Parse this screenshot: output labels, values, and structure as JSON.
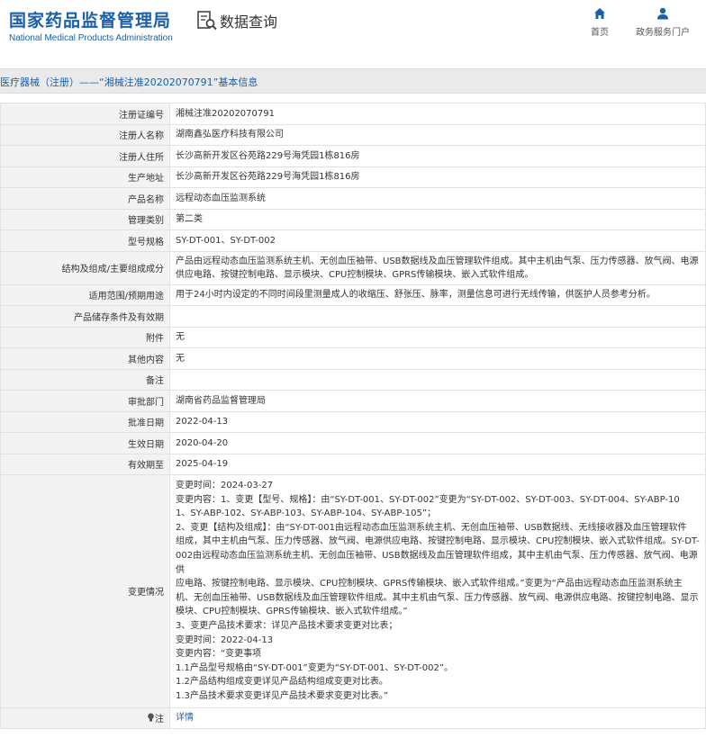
{
  "header": {
    "logo_cn": "国家药品监督管理局",
    "logo_en": "National Medical Products Administration",
    "query_title": "数据查询",
    "nav": [
      {
        "label": "首页",
        "icon": "home-icon"
      },
      {
        "label": "政务服务门户",
        "icon": "user-icon"
      }
    ]
  },
  "breadcrumb": "医疗器械（注册）——“湘械注准20202070791”基本信息",
  "rows": [
    {
      "label": "注册证编号",
      "value": "湘械注准20202070791"
    },
    {
      "label": "注册人名称",
      "value": "湖南鑫弘医疗科技有限公司"
    },
    {
      "label": "注册人住所",
      "value": "长沙高新开发区谷苑路229号海凭园1栋816房"
    },
    {
      "label": "生产地址",
      "value": "长沙高新开发区谷苑路229号海凭园1栋816房"
    },
    {
      "label": "产品名称",
      "value": "远程动态血压监测系统"
    },
    {
      "label": "管理类别",
      "value": "第二类"
    },
    {
      "label": "型号规格",
      "value": "SY-DT-001、SY-DT-002"
    },
    {
      "label": "结构及组成/主要组成成分",
      "value": "产品由远程动态血压监测系统主机、无创血压袖带、USB数据线及血压管理软件组成。其中主机由气泵、压力传感器、放气阀、电源供应电路、按键控制电路、显示模块、CPU控制模块、GPRS传输模块、嵌入式软件组成。"
    },
    {
      "label": "适用范围/预期用途",
      "value": "用于24小时内设定的不同时间段里测量成人的收缩压、舒张压、脉率，测量信息可进行无线传输，供医护人员参考分析。"
    },
    {
      "label": "产品储存条件及有效期",
      "value": ""
    },
    {
      "label": "附件",
      "value": "无"
    },
    {
      "label": "其他内容",
      "value": "无"
    },
    {
      "label": "备注",
      "value": ""
    },
    {
      "label": "审批部门",
      "value": "湖南省药品监督管理局"
    },
    {
      "label": "批准日期",
      "value": "2022-04-13"
    },
    {
      "label": "生效日期",
      "value": "2020-04-20"
    },
    {
      "label": "有效期至",
      "value": "2025-04-19"
    }
  ],
  "change": {
    "label": "变更情况",
    "lines": [
      "变更时间：2024-03-27",
      "变更内容：1、变更【型号、规格】：由“SY-DT-001、SY-DT-002”变更为“SY-DT-002、SY-DT-003、SY-DT-004、SY-ABP-10",
      "1、SY-ABP-102、SY-ABP-103、SY-ABP-104、SY-ABP-105”；",
      "2、变更【结构及组成】：由“SY-DT-001由远程动态血压监测系统主机、无创血压袖带、USB数据线、无线接收器及血压管理软件",
      "组成，其中主机由气泵、压力传感器、放气阀、电源供应电路、按键控制电路、显示模块、CPU控制模块、嵌入式软件组成。SY-DT-",
      "002由远程动态血压监测系统主机、无创血压袖带、USB数据线及血压管理软件组成，其中主机由气泵、压力传感器、放气阀、电源供",
      "应电路、按键控制电路、显示模块、CPU控制模块、GPRS传输模块、嵌入式软件组成。”变更为“产品由远程动态血压监测系统主",
      "机、无创血压袖带、USB数据线及血压管理软件组成。其中主机由气泵、压力传感器、放气阀、电源供应电路、按键控制电路、显示",
      "模块、CPU控制模块、GPRS传输模块、嵌入式软件组成。”",
      "3、变更产品技术要求：详见产品技术要求变更对比表；",
      "变更时间：2022-04-13",
      "变更内容：“变更事项",
      "1.1产品型号规格由“SY-DT-001”变更为“SY-DT-001、SY-DT-002”。",
      "1.2产品结构组成变更详见产品结构组成变更对比表。",
      "1.3产品技术要求变更详见产品技术要求变更对比表。”"
    ]
  },
  "note_row": {
    "label": "注",
    "link_label": "详情"
  },
  "colors": {
    "brand_blue": "#1b5fa8",
    "label_bg": "#f3f3f3",
    "breadcrumb_bg": "#eaeaea"
  }
}
